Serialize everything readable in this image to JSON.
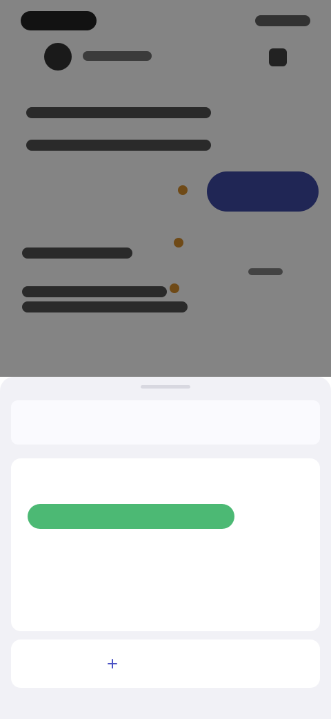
{
  "sheet": {
    "title": "",
    "card": {
      "label": "",
      "description": "",
      "bar_color": "#4cb974"
    },
    "action_label": "",
    "action_icon": "plus-icon"
  },
  "background": {
    "primary_button_color": "#2e3b9d",
    "marker_color": "#d4871d"
  }
}
